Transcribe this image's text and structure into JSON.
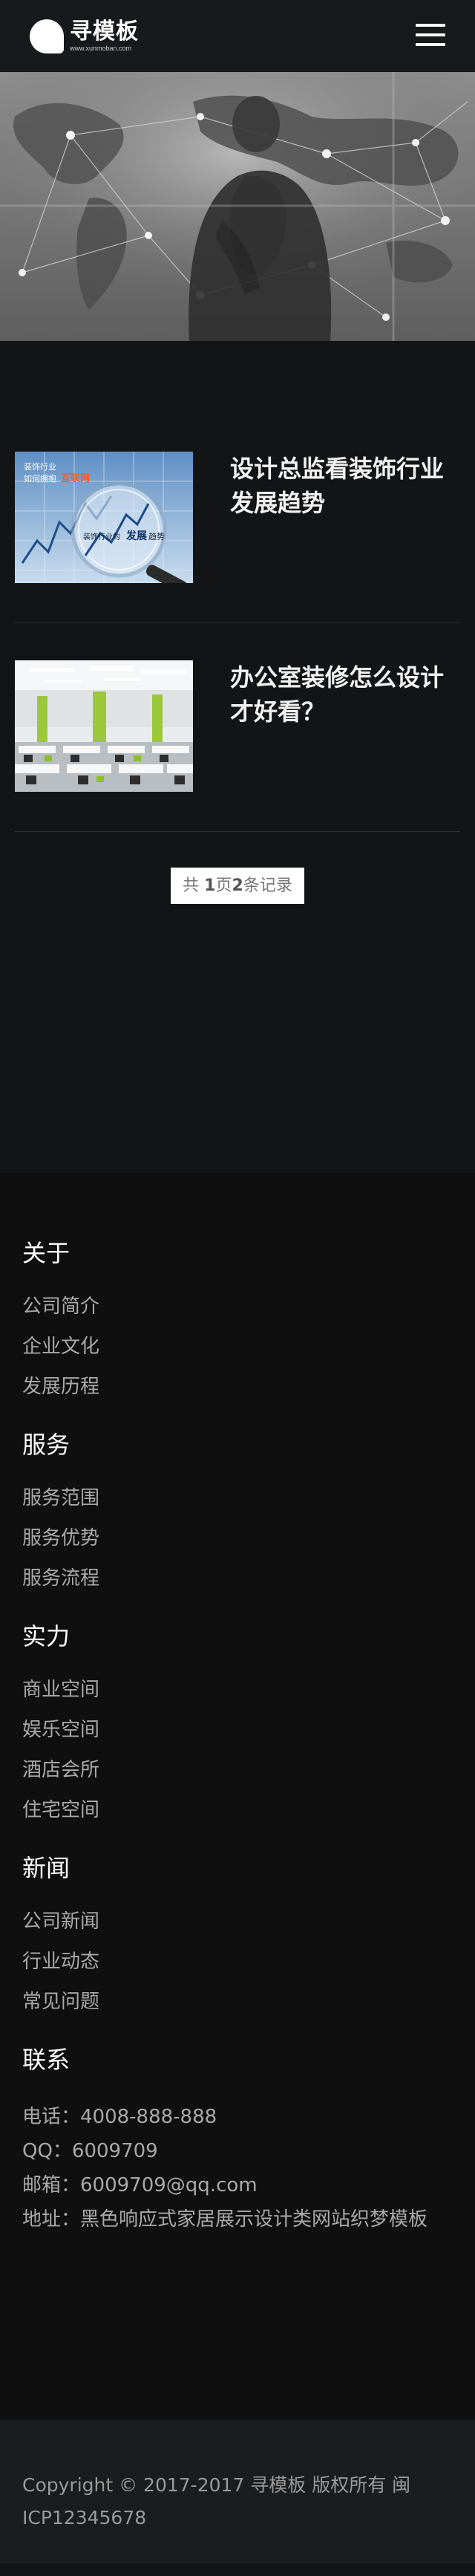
{
  "header": {
    "logo_cn": "寻模板",
    "logo_en": "www.xunmoban.com",
    "menu_icon": "hamburger-menu-icon"
  },
  "banner": {
    "description": ""
  },
  "articles": [
    {
      "title": "设计总监看装饰行业发展趋势",
      "thumb_text_1": "装饰行业",
      "thumb_text_2": "如何拥抱",
      "thumb_text_3": "互联网",
      "thumb_text_4": "装饰行业的",
      "thumb_text_5": "发展",
      "thumb_text_6": "趋势"
    },
    {
      "title": "办公室装修怎么设计才好看？"
    }
  ],
  "pager": {
    "prefix": "共 ",
    "pages": "1",
    "mid": "页",
    "records": "2",
    "suffix": "条记录"
  },
  "footer": {
    "sections": [
      {
        "title": "关于",
        "links": [
          "公司简介",
          "企业文化",
          "发展历程"
        ]
      },
      {
        "title": "服务",
        "links": [
          "服务范围",
          "服务优势",
          "服务流程"
        ]
      },
      {
        "title": "实力",
        "links": [
          "商业空间",
          "娱乐空间",
          "酒店会所",
          "住宅空间"
        ]
      },
      {
        "title": "新闻",
        "links": [
          "公司新闻",
          "行业动态",
          "常见问题"
        ]
      }
    ],
    "contact": {
      "title": "联系",
      "phone": "电话：4008-888-888",
      "qq": "QQ：6009709",
      "email": "邮箱：6009709@qq.com",
      "address": "地址：黑色响应式家居展示设计类网站织梦模板"
    }
  },
  "copyright": {
    "line1": "Copyright © 2017-2017 寻模板 版权所有     闽",
    "line2": "ICP12345678"
  }
}
